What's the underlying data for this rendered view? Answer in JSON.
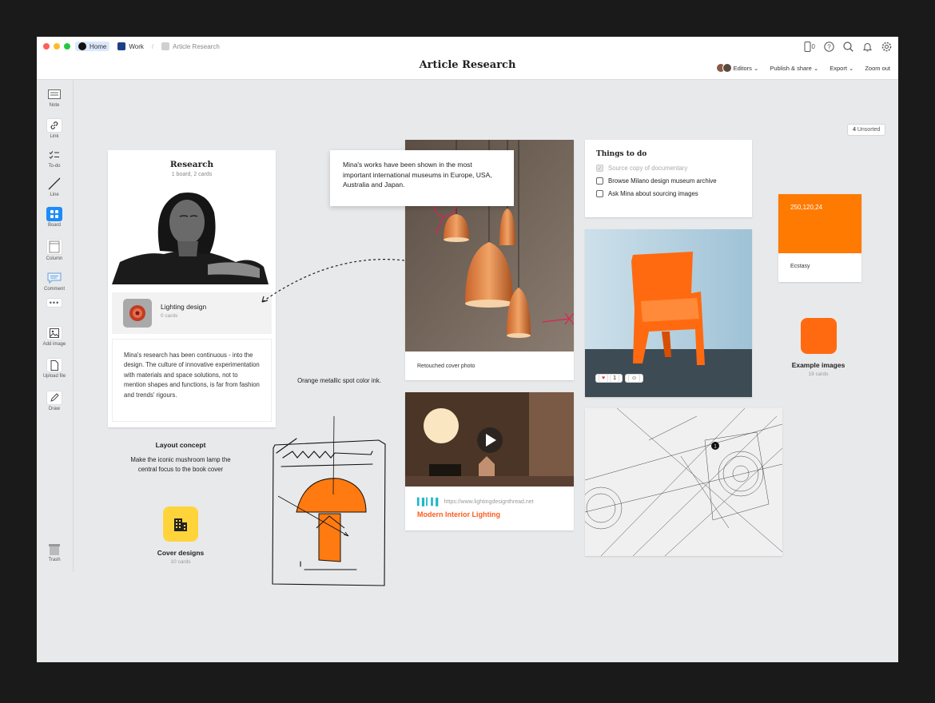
{
  "window": {
    "breadcrumbs": [
      {
        "label": "Home"
      },
      {
        "label": "Work"
      },
      {
        "label": "Article Research"
      }
    ],
    "phone_count": "0",
    "title": "Article Research",
    "menus": {
      "editors": "Editors",
      "publish": "Publish & share",
      "export": "Export",
      "zoom": "Zoom out"
    }
  },
  "toolbar": {
    "items": [
      {
        "label": "Note",
        "icon": "note-icon"
      },
      {
        "label": "Link",
        "icon": "link-icon"
      },
      {
        "label": "To-do",
        "icon": "todo-icon"
      },
      {
        "label": "Line",
        "icon": "line-icon"
      },
      {
        "label": "Board",
        "icon": "board-icon"
      },
      {
        "label": "Column",
        "icon": "column-icon"
      },
      {
        "label": "Comment",
        "icon": "comment-icon"
      },
      {
        "label": "Add image",
        "icon": "image-icon"
      },
      {
        "label": "Upload file",
        "icon": "file-icon"
      },
      {
        "label": "Draw",
        "icon": "pen-icon"
      }
    ],
    "trash": "Trash"
  },
  "research": {
    "title": "Research",
    "subtitle": "1 board, 2 cards",
    "sub_board": {
      "title": "Lighting design",
      "count": "0 cards"
    },
    "note": "Mina's research has been continuous - into the design. The culture of innovative experimentation with materials and space solutions, not to mention shapes and functions, is far from fashion and trends' rigours."
  },
  "quote": "Mina's works have been shown in the most important international museums in Europe, USA, Australia and Japan.",
  "lamps": {
    "caption": "Retouched cover photo"
  },
  "todo": {
    "title": "Things to do",
    "items": [
      {
        "label": "Source copy of documentary",
        "done": true
      },
      {
        "label": "Browse Milano design museum archive",
        "done": false
      },
      {
        "label": "Ask Mina about sourcing images",
        "done": false
      }
    ]
  },
  "unsorted": {
    "count": "4",
    "label": "Unsorted"
  },
  "swatch": {
    "value": "250,120,24",
    "name": "Ecstasy",
    "color": "#ff7a00"
  },
  "chair": {
    "reaction_count": "1"
  },
  "example_images": {
    "label": "Example images",
    "count": "19 cards"
  },
  "video": {
    "url": "https://www.lightingdesignthread.net",
    "title": "Modern Interior Lighting"
  },
  "layout": {
    "title": "Layout concept",
    "text": "Make the iconic mushroom lamp the central focus to the book cover"
  },
  "sketch_label": "Orange metallic spot color ink.",
  "cover_designs": {
    "label": "Cover designs",
    "count": "10 cards"
  },
  "colors": {
    "accent": "#1d8cf8",
    "orange": "#ff7a00",
    "link_orange": "#ff5a1f",
    "yellow": "#ffd43b"
  }
}
